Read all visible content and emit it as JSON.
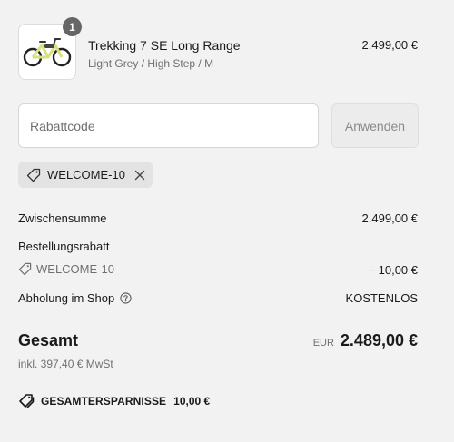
{
  "product": {
    "quantity": "1",
    "name": "Trekking 7 SE Long Range",
    "variant": "Light Grey / High Step / M",
    "price": "2.499,00 €"
  },
  "discount": {
    "placeholder": "Rabattcode",
    "value": "",
    "apply_label": "Anwenden",
    "applied_code": "WELCOME-10"
  },
  "summary": {
    "subtotal_label": "Zwischensumme",
    "subtotal_value": "2.499,00 €",
    "order_discount_label": "Bestellungsrabatt",
    "discount_code": "WELCOME-10",
    "discount_value": "− 10,00 €",
    "pickup_label": "Abholung im Shop",
    "pickup_value": "KOSTENLOS",
    "total_label": "Gesamt",
    "total_currency": "EUR",
    "total_value": "2.489,00 €",
    "tax_note": "inkl. 397,40 € MwSt",
    "savings_label": "GESAMTERSPARNISSE",
    "savings_value": "10,00 €"
  },
  "colors": {
    "background": "#f2f2f2",
    "badge": "#666666",
    "bike_frame": "#d8e080"
  },
  "icons": {
    "tag": "tag-icon",
    "close": "close-icon",
    "help": "help-circle-icon",
    "savings": "double-tag-icon"
  }
}
